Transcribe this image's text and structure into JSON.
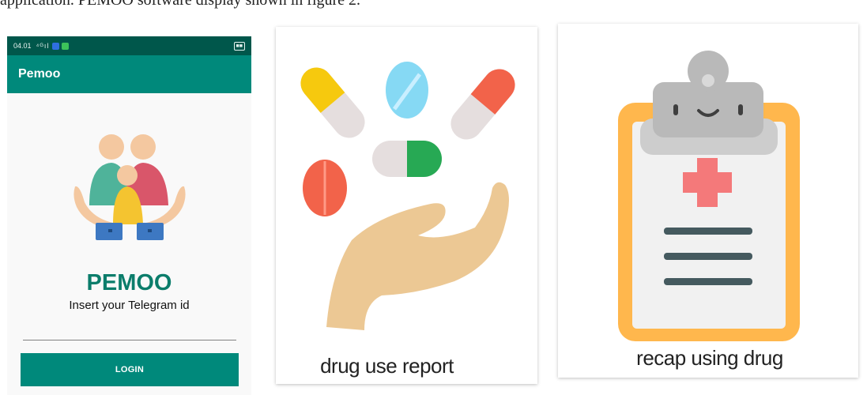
{
  "caption": "application. PEMOO software display shown in figure 2.",
  "phone": {
    "status": {
      "time": "04.01",
      "signal": "⁴ᴳıl"
    },
    "app_title": "Pemoo",
    "brand": "PEMOO",
    "subtitle": "Insert your Telegram id",
    "input": {
      "value": "",
      "placeholder": ""
    },
    "login_label": "LOGIN"
  },
  "cards": [
    {
      "label": "drug use report",
      "icon": "pills-hand-icon"
    },
    {
      "label": "recap using drug",
      "icon": "clipboard-icon"
    }
  ],
  "colors": {
    "status_bar": "#00574b",
    "app_bar": "#00897b",
    "brand_text": "#0b7d6b",
    "login_button": "#00897b",
    "clipboard_frame": "#ffb74d"
  }
}
